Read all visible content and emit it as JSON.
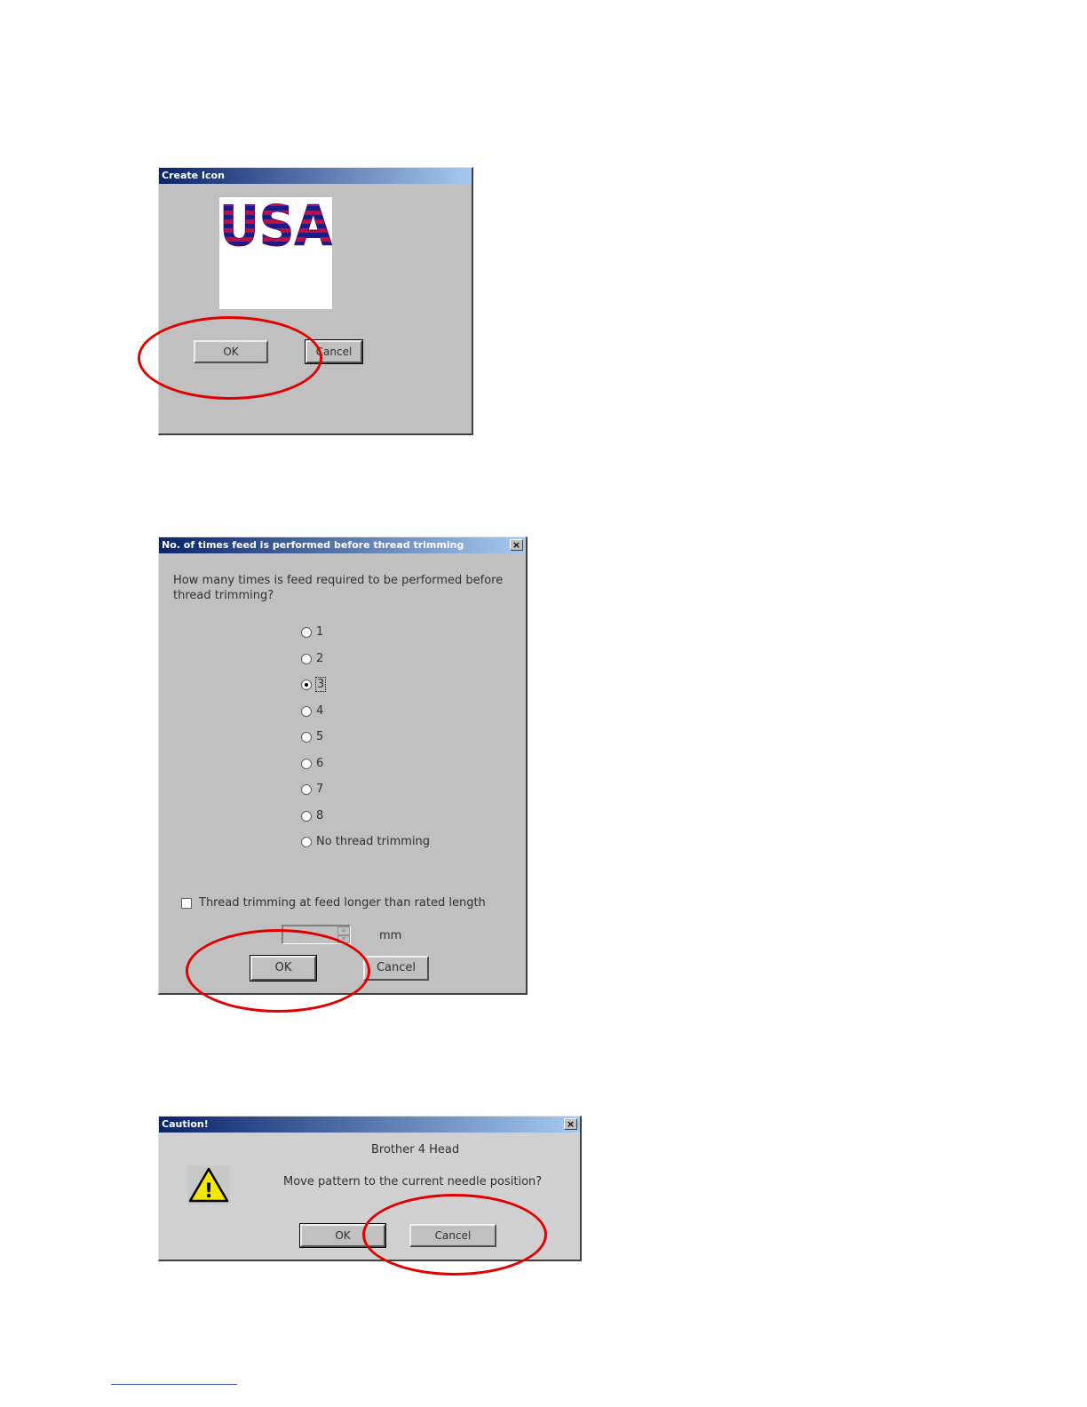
{
  "dialog_create_icon": {
    "title": "Create Icon",
    "preview_text": "USA",
    "ok_label": "OK",
    "cancel_label": "Cancel"
  },
  "dialog_feed": {
    "title": "No. of times feed is performed before thread trimming",
    "close_label": "×",
    "question_line1": "How many times is feed required to be performed before",
    "question_line2": "thread trimming?",
    "options": [
      "1",
      "2",
      "3",
      "4",
      "5",
      "6",
      "7",
      "8",
      "No thread trimming"
    ],
    "selected_option": "3",
    "checkbox_label": "Thread trimming at feed longer than rated length",
    "unit_label": "mm",
    "ok_label": "OK",
    "cancel_label": "Cancel"
  },
  "dialog_caution": {
    "title": "Caution!",
    "close_label": "×",
    "heading": "Brother 4 Head",
    "message": "Move pattern to the current needle position?",
    "warning_glyph": "!",
    "ok_label": "OK",
    "cancel_label": "Cancel"
  },
  "colors": {
    "highlight_ellipse": "#e00000",
    "usa_fill": "#c0103a",
    "usa_stripe": "#1a1a8a"
  }
}
